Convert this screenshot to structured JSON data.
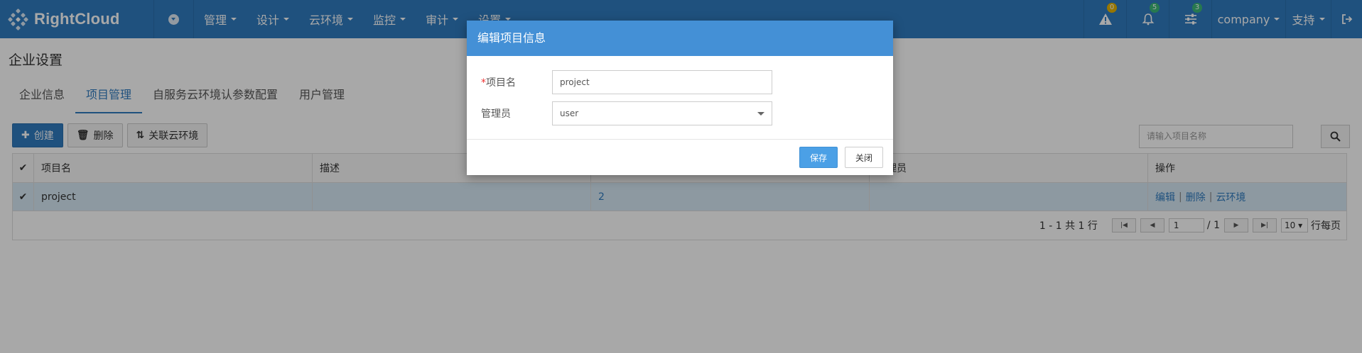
{
  "brand": {
    "name": "RightCloud"
  },
  "topnav": {
    "menus": [
      "管理",
      "设计",
      "云环境",
      "监控",
      "审计",
      "设置"
    ],
    "alerts": {
      "icon": "warning-icon",
      "count": "0",
      "color": "#e6b400"
    },
    "notifications": {
      "icon": "bell-icon",
      "count": "5",
      "color": "#3cb878"
    },
    "tasks": {
      "icon": "sliders-icon",
      "count": "3",
      "color": "#3cb878"
    },
    "user": "company",
    "support": "支持",
    "logout_icon": "logout-icon"
  },
  "page": {
    "title": "企业设置",
    "tabs": [
      "企业信息",
      "项目管理",
      "自服务云环境认参数配置",
      "用户管理"
    ],
    "active_tab": "项目管理"
  },
  "toolbar": {
    "create": "创建",
    "delete": "删除",
    "link_env": "关联云环境",
    "search_placeholder": "请输入项目名称"
  },
  "table": {
    "columns": [
      "项目名",
      "描述",
      "",
      "管理员",
      "操作"
    ],
    "rows": [
      {
        "name": "project",
        "description": "",
        "count": "2",
        "admin": "",
        "actions": [
          "编辑",
          "删除",
          "云环境"
        ]
      }
    ]
  },
  "pager": {
    "summary": "1 - 1 共 1 行",
    "page": "1",
    "total_pages": "/ 1",
    "page_size": "10",
    "per_page_label": "行每页"
  },
  "modal": {
    "title": "编辑项目信息",
    "fields": [
      {
        "label": "项目名",
        "required": "*",
        "value": "project"
      },
      {
        "label": "管理员",
        "value": "user"
      }
    ],
    "save": "保存",
    "close": "关闭"
  }
}
